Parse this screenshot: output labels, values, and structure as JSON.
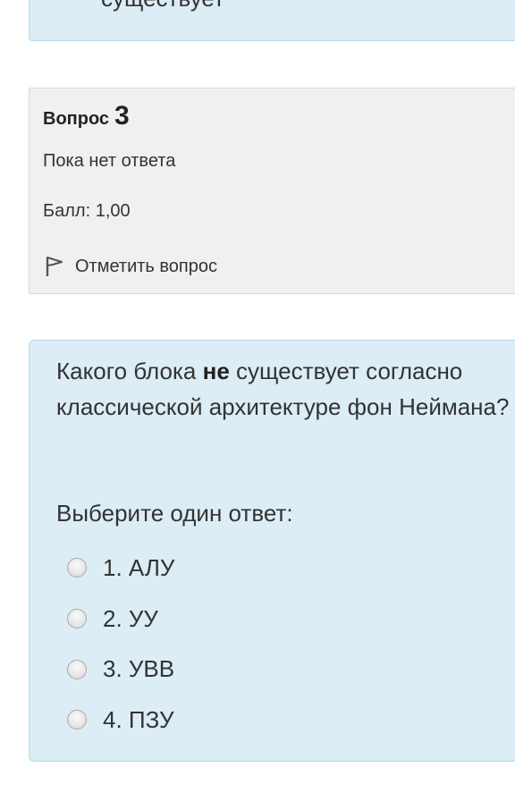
{
  "previous_question": {
    "text_tail": "существует"
  },
  "info": {
    "question_label": "Вопрос",
    "question_number": "3",
    "state": "Пока нет ответа",
    "grade": "Балл: 1,00",
    "flag_label": "Отметить вопрос"
  },
  "question": {
    "text_before": "Какого блока ",
    "text_bold": "не",
    "text_after": " существует согласно классической архитектуре фон Неймана?",
    "prompt": "Выберите один ответ:",
    "answers": [
      {
        "label": "1. АЛУ",
        "selected": false
      },
      {
        "label": "2. УУ",
        "selected": false
      },
      {
        "label": "3. УВВ",
        "selected": false
      },
      {
        "label": "4. ПЗУ",
        "selected": false
      }
    ]
  },
  "colors": {
    "content_bg": "#dcedf5",
    "info_bg": "#f0f0f0"
  }
}
